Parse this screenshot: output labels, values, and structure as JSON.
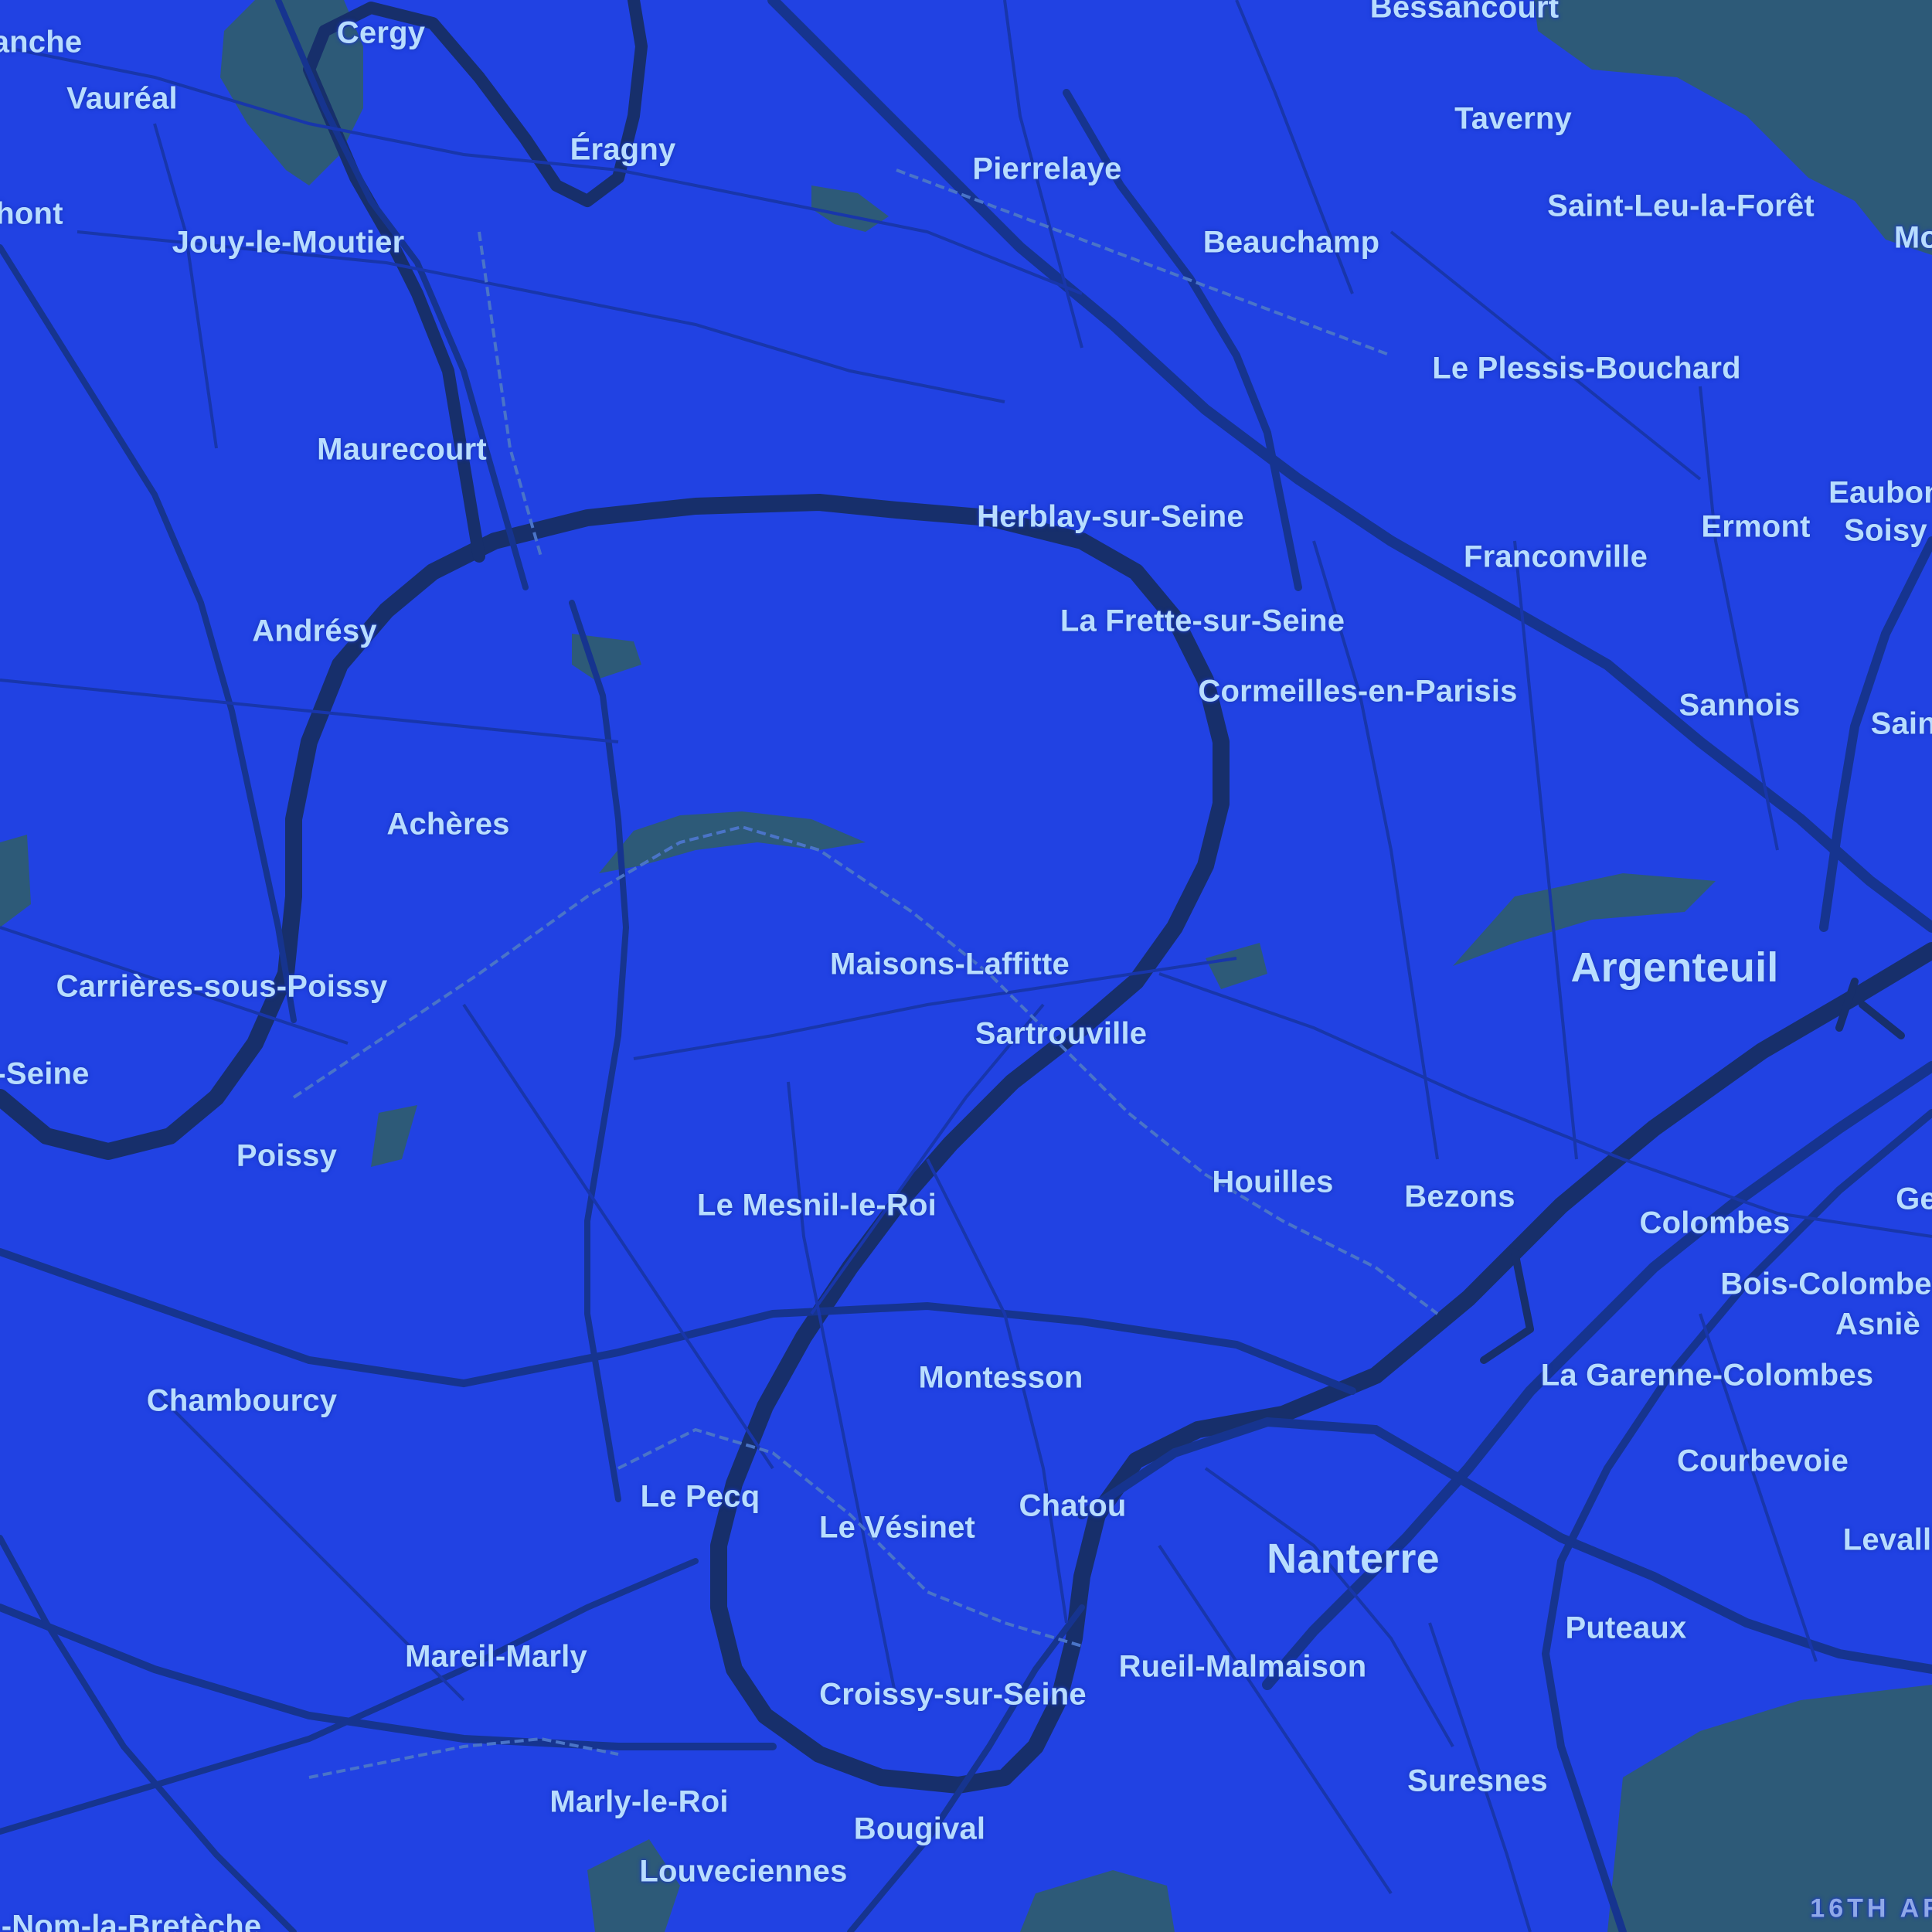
{
  "map": {
    "colors": {
      "land": "#2142e3",
      "water": "#172f6b",
      "road_major": "#16348f",
      "road_minor": "#1836ab",
      "green": "#2d5a78",
      "rail": "#4a74c8",
      "label": "#b8ddff",
      "label_halo": "#1c3ac0"
    },
    "places": [
      {
        "id": "cergy",
        "name": "Cergy"
      },
      {
        "id": "vaureal",
        "name": "Vauréal"
      },
      {
        "id": "anche",
        "name": "anche"
      },
      {
        "id": "hont",
        "name": "hont"
      },
      {
        "id": "eragny",
        "name": "Éragny"
      },
      {
        "id": "jouy",
        "name": "Jouy-le-Moutier"
      },
      {
        "id": "pierrelaye",
        "name": "Pierrelaye"
      },
      {
        "id": "bessancourt",
        "name": "Bessancourt"
      },
      {
        "id": "taverny",
        "name": "Taverny"
      },
      {
        "id": "saintleu",
        "name": "Saint-Leu-la-Forêt"
      },
      {
        "id": "mo",
        "name": "Mo"
      },
      {
        "id": "beauchamp",
        "name": "Beauchamp"
      },
      {
        "id": "plessis",
        "name": "Le Plessis-Bouchard"
      },
      {
        "id": "maurecourt",
        "name": "Maurecourt"
      },
      {
        "id": "herblay",
        "name": "Herblay-sur-Seine"
      },
      {
        "id": "eaubon",
        "name": "Eaubon"
      },
      {
        "id": "ermont",
        "name": "Ermont"
      },
      {
        "id": "soisy",
        "name": "Soisy"
      },
      {
        "id": "franconville",
        "name": "Franconville"
      },
      {
        "id": "andresy",
        "name": "Andrésy"
      },
      {
        "id": "frette",
        "name": "La Frette-sur-Seine"
      },
      {
        "id": "cormeilles",
        "name": "Cormeilles-en-Parisis"
      },
      {
        "id": "sannois",
        "name": "Sannois"
      },
      {
        "id": "saint",
        "name": "Saint"
      },
      {
        "id": "acheres",
        "name": "Achères"
      },
      {
        "id": "argenteuil",
        "name": "Argenteuil",
        "size": "big"
      },
      {
        "id": "maisons",
        "name": "Maisons-Laffitte"
      },
      {
        "id": "carrieres",
        "name": "Carrières-sous-Poissy"
      },
      {
        "id": "sartrouville",
        "name": "Sartrouville"
      },
      {
        "id": "seine",
        "name": "-Seine"
      },
      {
        "id": "poissy",
        "name": "Poissy"
      },
      {
        "id": "houilles",
        "name": "Houilles"
      },
      {
        "id": "bezons",
        "name": "Bezons"
      },
      {
        "id": "ge",
        "name": "Ge"
      },
      {
        "id": "mesnil",
        "name": "Le Mesnil-le-Roi"
      },
      {
        "id": "colombes",
        "name": "Colombes"
      },
      {
        "id": "boiscolombes",
        "name": "Bois-Colombe"
      },
      {
        "id": "asnie",
        "name": "Asniè"
      },
      {
        "id": "montesson",
        "name": "Montesson"
      },
      {
        "id": "garenne",
        "name": "La Garenne-Colombes"
      },
      {
        "id": "chambourcy",
        "name": "Chambourcy"
      },
      {
        "id": "courbevoie",
        "name": "Courbevoie"
      },
      {
        "id": "chatou",
        "name": "Chatou"
      },
      {
        "id": "lepecq",
        "name": "Le Pecq"
      },
      {
        "id": "levallois",
        "name": "Levall"
      },
      {
        "id": "vesinet",
        "name": "Le Vésinet"
      },
      {
        "id": "nanterre",
        "name": "Nanterre",
        "size": "big"
      },
      {
        "id": "puteaux",
        "name": "Puteaux"
      },
      {
        "id": "mareil",
        "name": "Mareil-Marly"
      },
      {
        "id": "rueil",
        "name": "Rueil-Malmaison"
      },
      {
        "id": "croissy",
        "name": "Croissy-sur-Seine"
      },
      {
        "id": "suresnes",
        "name": "Suresnes"
      },
      {
        "id": "marly",
        "name": "Marly-le-Roi"
      },
      {
        "id": "bougival",
        "name": "Bougival"
      },
      {
        "id": "louveciennes",
        "name": "Louveciennes"
      },
      {
        "id": "nom",
        "name": "-Nom-la-Bretèche"
      },
      {
        "id": "arr16",
        "name": "16TH AR",
        "size": "district"
      }
    ]
  }
}
